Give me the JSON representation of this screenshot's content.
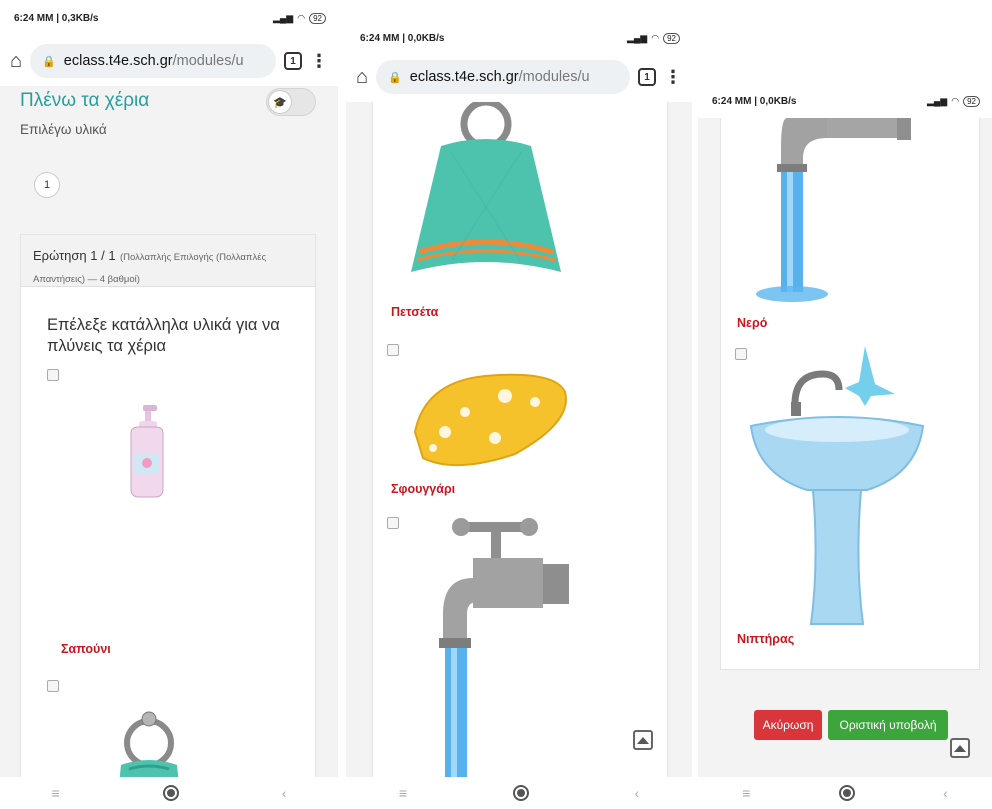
{
  "status": {
    "p1": "6:24 MM | 0,3KB/s",
    "p2": "6:24 MM | 0,0KB/s",
    "p3": "6:24 MM | 0,0KB/s",
    "battery": "92"
  },
  "browser": {
    "url_domain": "eclass.t4e.sch.gr",
    "url_path": "/modules/u",
    "tab_count": "1"
  },
  "course": {
    "title": "Πλένω τα χέρια",
    "subtitle": "Επιλέγω υλικά",
    "page_number": "1"
  },
  "question": {
    "header": "Ερώτηση 1 / 1",
    "meta": "(Πολλαπλής Επιλογής (Πολλαπλές Απαντήσεις) — 4 βαθμοί)",
    "text": "Επέλεξε κατάλληλα υλικά για να πλύνεις τα χέρια"
  },
  "options": {
    "soap": "Σαπούνι",
    "towel": "Πετσέτα",
    "sponge": "Σφουγγάρι",
    "water": "Νερό",
    "sink": "Νιπτήρας"
  },
  "actions": {
    "cancel": "Ακύρωση",
    "submit": "Οριστική υποβολή"
  },
  "nav_icons": [
    "menu-icon",
    "home-icon",
    "back-icon"
  ],
  "colors": {
    "title_teal": "#2a9d9a",
    "label_red": "#c9171e",
    "cancel_red": "#d9363b",
    "submit_green": "#3ca53c"
  }
}
